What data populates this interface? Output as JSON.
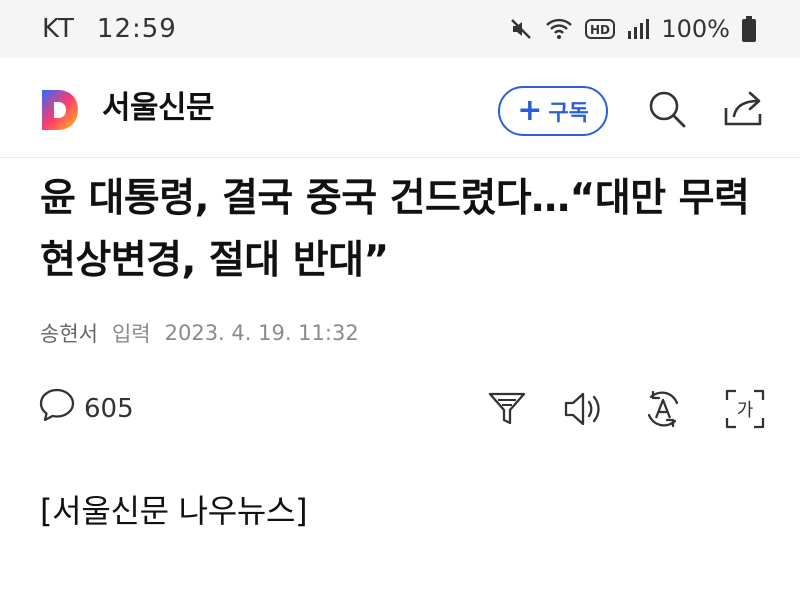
{
  "status_bar": {
    "carrier": "KT",
    "time": "12:59",
    "network_badge": "HD",
    "battery": "100%",
    "icons": [
      "mute-icon",
      "wifi-icon",
      "hd-icon",
      "signal-icon",
      "battery-icon"
    ]
  },
  "header": {
    "press_name": "서울신문",
    "subscribe_label": "구독",
    "icons": [
      "daum-logo-icon",
      "search-icon",
      "share-icon"
    ]
  },
  "article": {
    "headline": "윤 대통령, 결국 중국 건드렸다…“대만 무력 현상변경, 절대 반대”",
    "reporter": "송현서",
    "input_label": "입력",
    "datetime": "2023. 4. 19. 11:32",
    "comment_count": "605",
    "lead": "[서울신문 나우뉴스]"
  },
  "tools": {
    "icons": [
      "comment-icon",
      "summary-icon",
      "text-to-speech-icon",
      "translate-icon",
      "font-size-icon"
    ],
    "font_icon_glyph": "가"
  },
  "colors": {
    "accent": "#2b5fd9",
    "status_bar_bg": "#f5f5f5",
    "meta_text": "#8a8a8a"
  }
}
